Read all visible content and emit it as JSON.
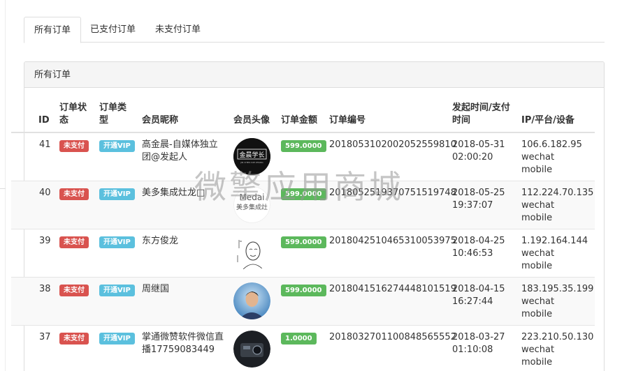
{
  "tabs": [
    {
      "label": "所有订单",
      "active": true
    },
    {
      "label": "已支付订单",
      "active": false
    },
    {
      "label": "未支付订单",
      "active": false
    }
  ],
  "panel": {
    "title": "所有订单"
  },
  "columns": {
    "id": "ID",
    "status": "订单状态",
    "type": "订单类型",
    "nickname": "会员昵称",
    "avatar": "会员头像",
    "amount": "订单金额",
    "order_no": "订单编号",
    "time": "发起时间/支付时间",
    "ip": "IP/平台/设备"
  },
  "orders": [
    {
      "id": "41",
      "status": "未支付",
      "type": "开通VIP",
      "nickname": "高金晨-自媒体独立团@发起人",
      "amount": "599.0000",
      "order_no": "20180531020020525598​10",
      "date": "2018-05-31",
      "time": "02:00:20",
      "ip": "106.6.182.95",
      "platform": "wechat",
      "device": "mobile",
      "avatar_text": "金晨学长"
    },
    {
      "id": "40",
      "status": "未支付",
      "type": "开通VIP",
      "nickname": "美多集成灶龙□",
      "amount": "599.0000",
      "order_no": "20180525193707515197​48",
      "date": "2018-05-25",
      "time": "19:37:07",
      "ip": "112.224.70.135",
      "platform": "wechat",
      "device": "mobile",
      "avatar_text": "美多集成灶"
    },
    {
      "id": "39",
      "status": "未支付",
      "type": "开通VIP",
      "nickname": "东方俊龙",
      "amount": "599.0000",
      "order_no": "20180425104653100539​75",
      "date": "2018-04-25",
      "time": "10:46:53",
      "ip": "1.192.164.144",
      "platform": "wechat",
      "device": "mobile",
      "avatar_text": ""
    },
    {
      "id": "38",
      "status": "未支付",
      "type": "开通VIP",
      "nickname": "周继国",
      "amount": "599.0000",
      "order_no": "20180415162744481015​19",
      "date": "2018-04-15",
      "time": "16:27:44",
      "ip": "183.195.35.199",
      "platform": "wechat",
      "device": "mobile",
      "avatar_text": ""
    },
    {
      "id": "37",
      "status": "未支付",
      "type": "开通VIP",
      "nickname": "掌通微赞软件微信直播17759083449",
      "amount": "1.0000",
      "order_no": "20180327011008485655​52",
      "date": "2018-03-27",
      "time": "01:10:08",
      "ip": "223.210.50.130",
      "platform": "wechat",
      "device": "mobile",
      "avatar_text": ""
    }
  ],
  "watermark": "微擎应用商城",
  "colors": {
    "danger": "#d9534f",
    "info": "#5bc0de",
    "success": "#5cb85c"
  }
}
